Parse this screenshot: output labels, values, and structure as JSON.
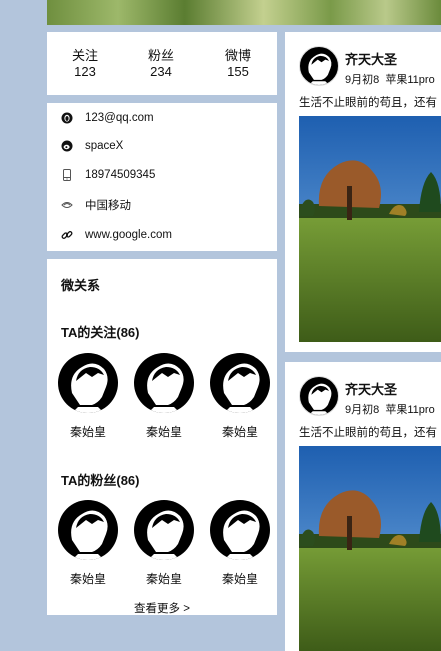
{
  "stats": [
    {
      "label": "关注",
      "value": "123"
    },
    {
      "label": "粉丝",
      "value": "234"
    },
    {
      "label": "微博",
      "value": "155"
    }
  ],
  "info": {
    "email": "123@qq.com",
    "username": "spaceX",
    "phone": "18974509345",
    "carrier": "中国移动",
    "website": "www.google.com"
  },
  "relations": {
    "title": "微关系",
    "following_title": "TA的关注(86)",
    "followers_title": "TA的粉丝(86)",
    "following": [
      "秦始皇",
      "秦始皇",
      "秦始皇"
    ],
    "followers": [
      "秦始皇",
      "秦始皇",
      "秦始皇"
    ],
    "more_label": "查看更多 >"
  },
  "posts": [
    {
      "author": "齐天大圣",
      "date": "9月初8",
      "device": "苹果11pro",
      "text": "生活不止眼前的苟且，还有"
    },
    {
      "author": "齐天大圣",
      "date": "9月初8",
      "device": "苹果11pro",
      "text": "生活不止眼前的苟且，还有"
    }
  ],
  "icons": [
    "qq-icon",
    "weibo-icon",
    "phone-icon",
    "carrier-icon",
    "link-icon"
  ]
}
